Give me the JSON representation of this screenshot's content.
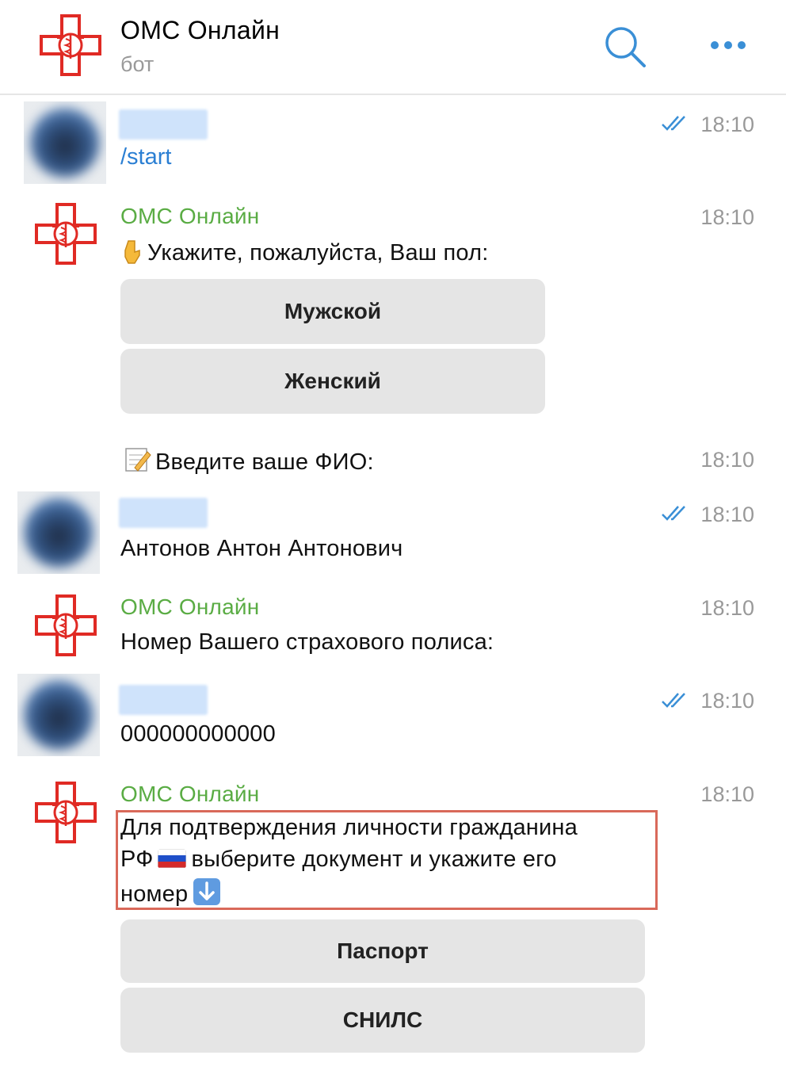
{
  "header": {
    "title": "ОМС Онлайн",
    "subtitle": "бот"
  },
  "messages": {
    "m1": {
      "text": "/start",
      "time": "18:10"
    },
    "m2": {
      "sender": "ОМС Онлайн",
      "text": "Укажите, пожалуйста, Ваш пол:",
      "time": "18:10",
      "buttons": [
        "Мужской",
        "Женский"
      ]
    },
    "m3": {
      "text": "Введите ваше ФИО:",
      "time": "18:10"
    },
    "m4": {
      "text": "Антонов Антон Антонович",
      "time": "18:10"
    },
    "m5": {
      "sender": "ОМС Онлайн",
      "text": "Номер Вашего страхового полиса:",
      "time": "18:10"
    },
    "m6": {
      "text": "000000000000",
      "time": "18:10"
    },
    "m7": {
      "sender": "ОМС Онлайн",
      "line1": "Для подтверждения личности гражданина",
      "line2a": "РФ",
      "line2b": "выберите документ и укажите его",
      "line3": "номер",
      "time": "18:10",
      "buttons": [
        "Паспорт",
        "СНИЛС"
      ]
    }
  },
  "icons": {
    "logo": "red-medical-cross-logo",
    "search": "search-icon",
    "more": "more-dots-icon",
    "read": "double-check-icon",
    "hand": "pointing-down-hand-icon",
    "memo": "memo-icon",
    "flag": "russia-flag-icon",
    "arrow": "down-arrow-icon"
  },
  "colors": {
    "bot_name": "#5aac44",
    "link": "#2b7fd3",
    "accent": "#3a8fd6",
    "logo_red": "#e02a24",
    "highlight": "#d9695a"
  }
}
